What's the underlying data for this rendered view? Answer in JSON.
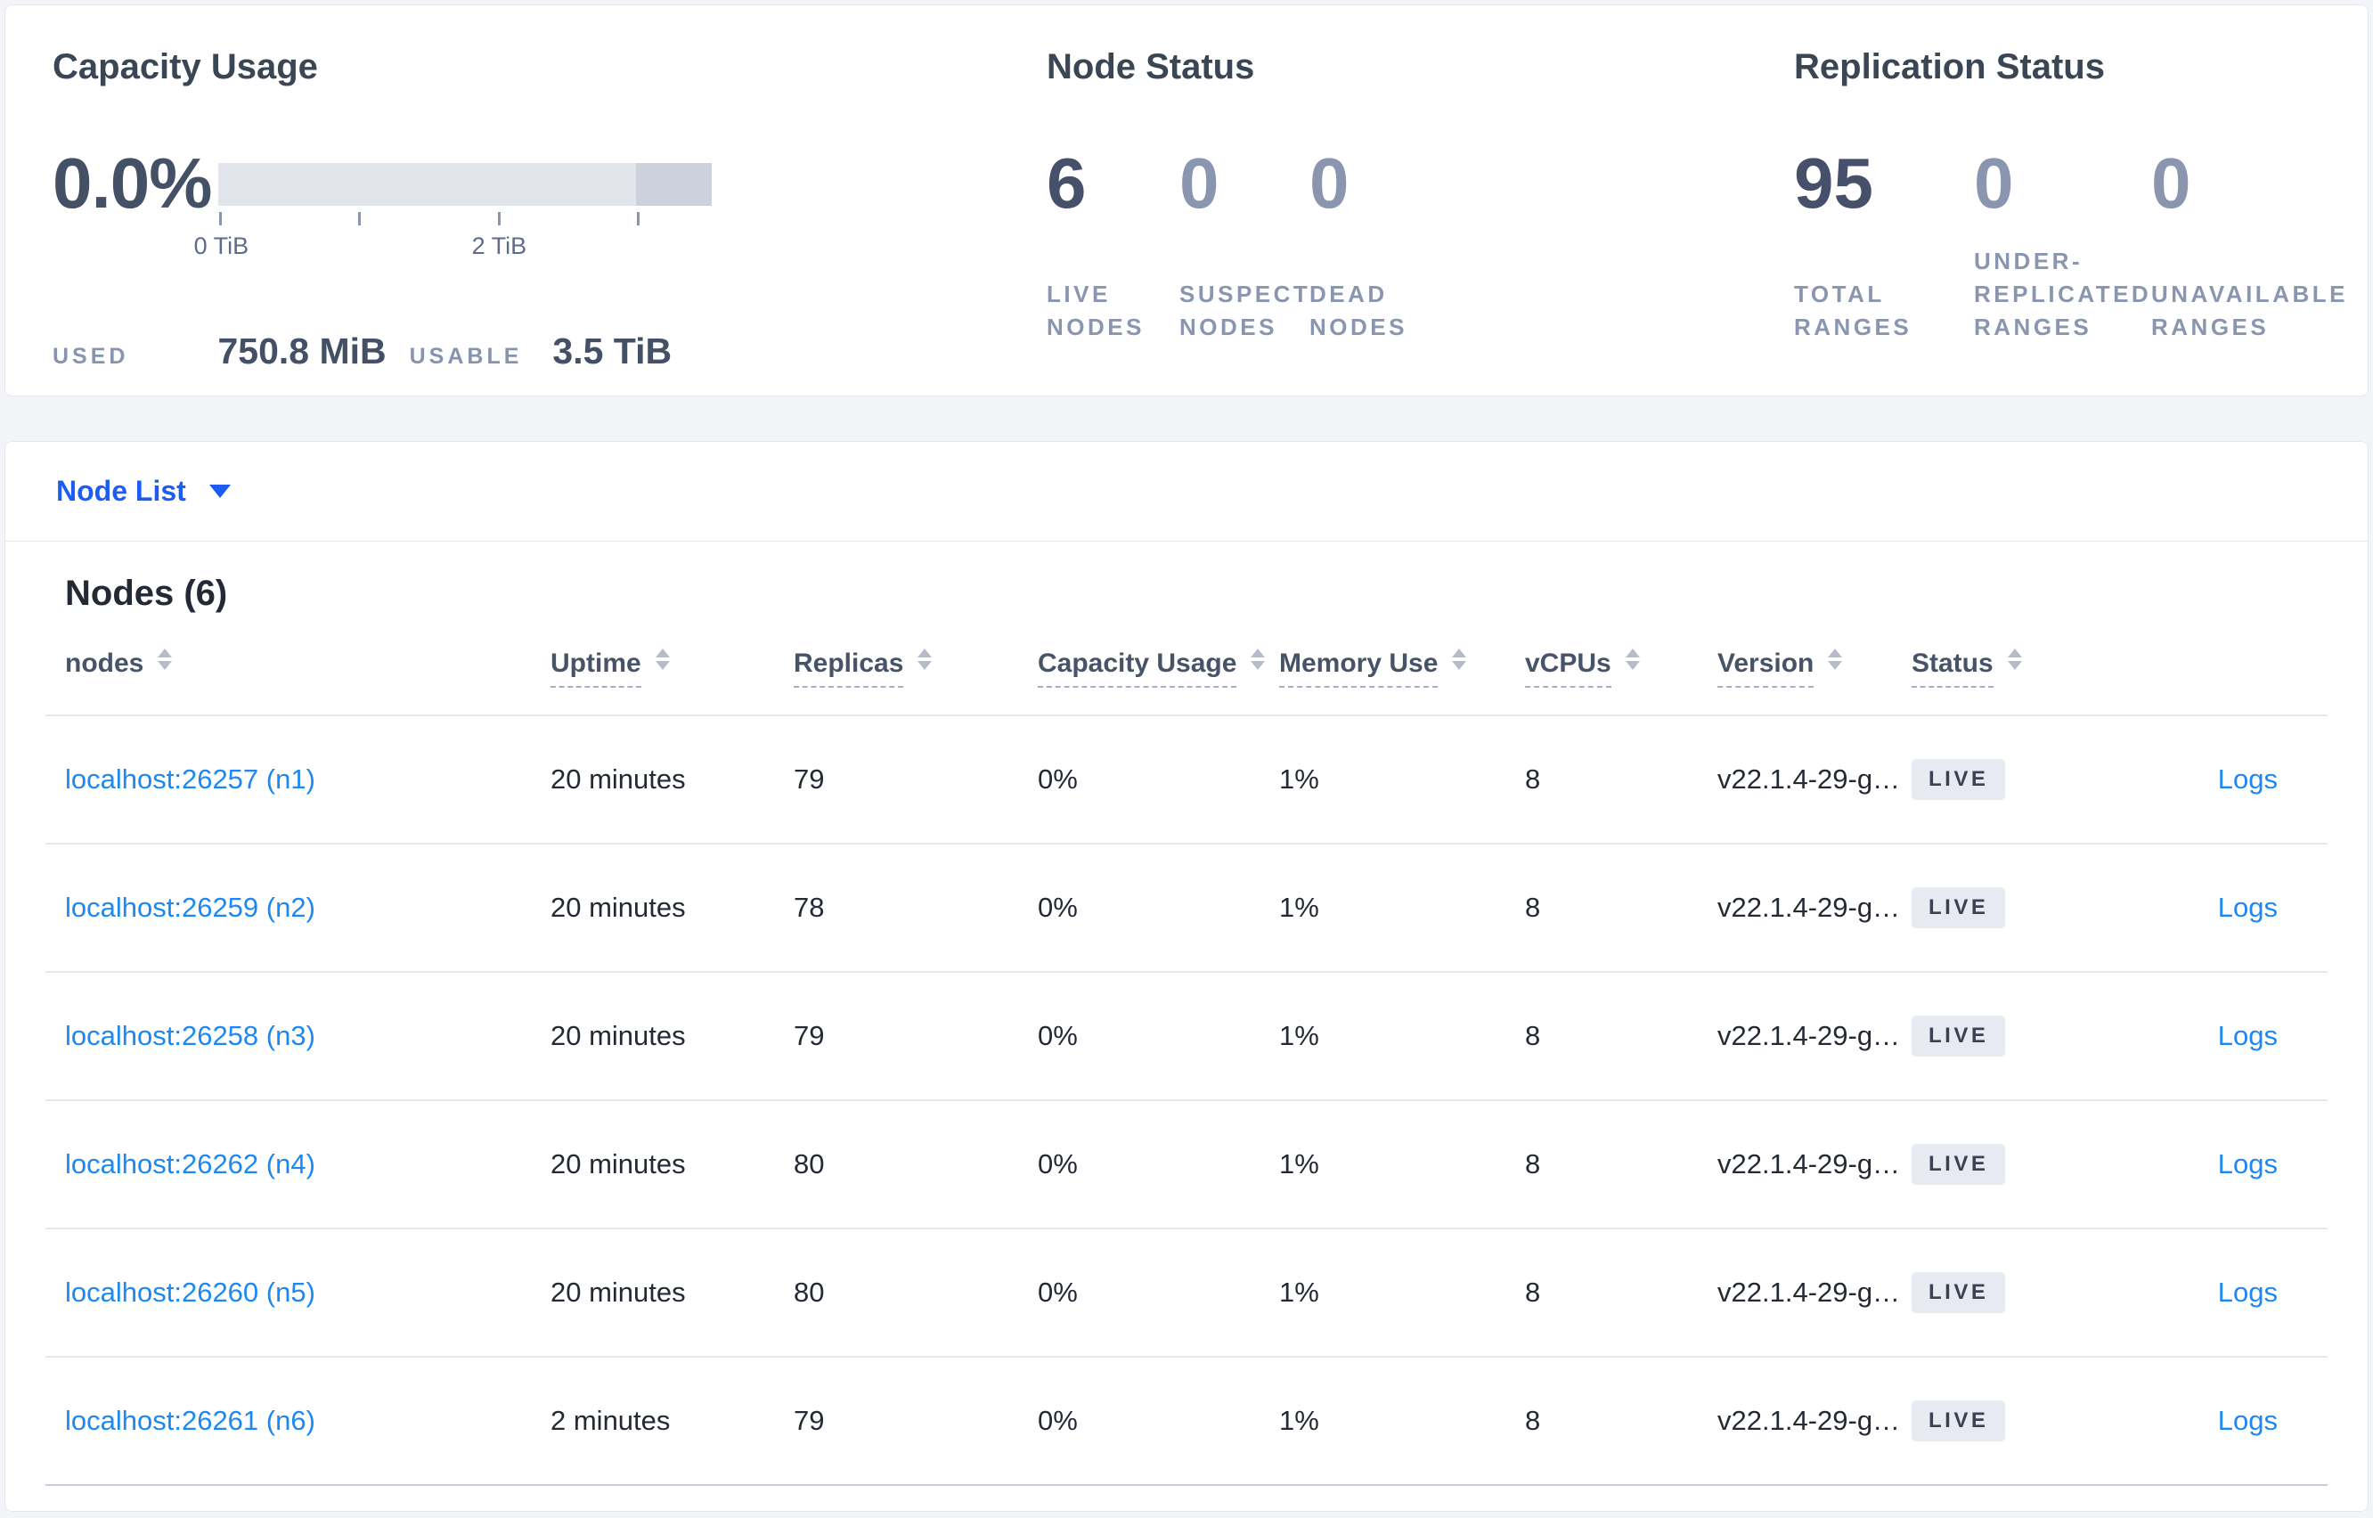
{
  "colors": {
    "accent_blue": "#1c5cf5",
    "link_blue": "#1e88f2",
    "badge_bg": "#e7eaf1",
    "primary_slate": "#445065",
    "dim_slate": "#8a95af"
  },
  "capacity": {
    "title": "Capacity Usage",
    "percent": "0.0%",
    "tick_label_0": "0 TiB",
    "tick_label_2": "2 TiB",
    "used_label": "USED",
    "used_value": "750.8 MiB",
    "usable_label": "USABLE",
    "usable_value": "3.5 TiB"
  },
  "node_status": {
    "title": "Node Status",
    "stats": [
      {
        "value": "6",
        "label": "LIVE\nNODES"
      },
      {
        "value": "0",
        "label": "SUSPECT\nNODES"
      },
      {
        "value": "0",
        "label": "DEAD\nNODES"
      }
    ]
  },
  "replication": {
    "title": "Replication Status",
    "stats": [
      {
        "value": "95",
        "label": "TOTAL\nRANGES"
      },
      {
        "value": "0",
        "label": "UNDER-\nREPLICATED\nRANGES"
      },
      {
        "value": "0",
        "label": "UNAVAILABLE\nRANGES"
      }
    ]
  },
  "node_list": {
    "label": "Node List"
  },
  "nodes_section": {
    "heading": "Nodes (6)"
  },
  "table": {
    "columns": [
      "nodes",
      "Uptime",
      "Replicas",
      "Capacity Usage",
      "Memory Use",
      "vCPUs",
      "Version",
      "Status"
    ],
    "logs_label": "Logs",
    "rows": [
      {
        "node": "localhost:26257 (n1)",
        "uptime": "20 minutes",
        "replicas": "79",
        "capacity": "0%",
        "memory": "1%",
        "vcpus": "8",
        "version": "v22.1.4-29-g…",
        "status": "LIVE"
      },
      {
        "node": "localhost:26259 (n2)",
        "uptime": "20 minutes",
        "replicas": "78",
        "capacity": "0%",
        "memory": "1%",
        "vcpus": "8",
        "version": "v22.1.4-29-g…",
        "status": "LIVE"
      },
      {
        "node": "localhost:26258 (n3)",
        "uptime": "20 minutes",
        "replicas": "79",
        "capacity": "0%",
        "memory": "1%",
        "vcpus": "8",
        "version": "v22.1.4-29-g…",
        "status": "LIVE"
      },
      {
        "node": "localhost:26262 (n4)",
        "uptime": "20 minutes",
        "replicas": "80",
        "capacity": "0%",
        "memory": "1%",
        "vcpus": "8",
        "version": "v22.1.4-29-g…",
        "status": "LIVE"
      },
      {
        "node": "localhost:26260 (n5)",
        "uptime": "20 minutes",
        "replicas": "80",
        "capacity": "0%",
        "memory": "1%",
        "vcpus": "8",
        "version": "v22.1.4-29-g…",
        "status": "LIVE"
      },
      {
        "node": "localhost:26261 (n6)",
        "uptime": "2 minutes",
        "replicas": "79",
        "capacity": "0%",
        "memory": "1%",
        "vcpus": "8",
        "version": "v22.1.4-29-g…",
        "status": "LIVE"
      }
    ]
  }
}
